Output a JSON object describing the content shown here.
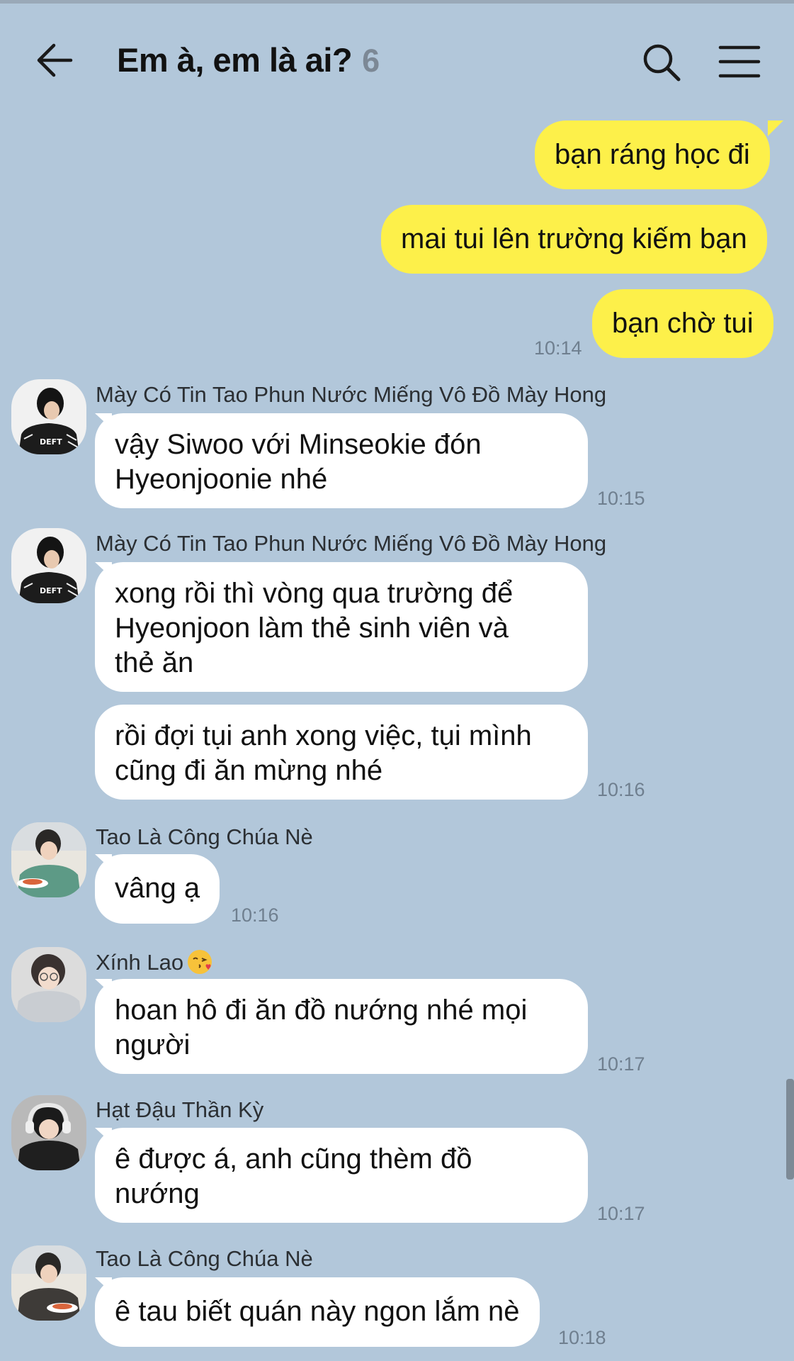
{
  "header": {
    "title": "Em à, em là ai?",
    "member_count": "6",
    "back_icon": "arrow-left-icon",
    "search_icon": "search-icon",
    "menu_icon": "hamburger-menu-icon"
  },
  "colors": {
    "background": "#b2c7da",
    "my_bubble": "#fdf04a",
    "other_bubble": "#ffffff",
    "time_text": "#6f7f8f"
  },
  "messages": [
    {
      "from": "me",
      "text": "bạn ráng học đi"
    },
    {
      "from": "me",
      "text": "mai tui lên trường kiếm bạn"
    },
    {
      "from": "me",
      "text": "bạn chờ tui",
      "time": "10:14"
    },
    {
      "sender": "Mày Có Tin Tao Phun Nước Miếng Vô Đồ Mày Hong",
      "avatar_text": "DEFT",
      "lines": [
        "vậy Siwoo với Minseokie đón",
        "Hyeonjoonie nhé"
      ],
      "time": "10:15"
    },
    {
      "sender": "Mày Có Tin Tao Phun Nước Miếng Vô Đồ Mày Hong",
      "avatar_text": "DEFT",
      "lines": [
        "xong rồi thì vòng qua trường để",
        "Hyeonjoon làm thẻ sinh viên và",
        "thẻ ăn"
      ]
    },
    {
      "lines": [
        "rồi đợi tụi anh xong việc, tụi mình",
        "cũng đi ăn mừng nhé"
      ],
      "time": "10:16"
    },
    {
      "sender": "Tao Là Công Chúa Nè",
      "lines": [
        "vâng ạ"
      ],
      "time": "10:16"
    },
    {
      "sender": "Xính Lao",
      "sender_emoji": "face-blowing-kiss-emoji",
      "lines": [
        "hoan hô đi ăn đồ nướng nhé mọi",
        "người"
      ],
      "time": "10:17"
    },
    {
      "sender": "Hạt Đậu Thần Kỳ",
      "lines": [
        "ê được á, anh cũng thèm đồ",
        "nướng"
      ],
      "time": "10:17"
    },
    {
      "sender": "Tao Là Công Chúa Nè",
      "lines": [
        "ê tau biết quán này ngon lắm nè"
      ],
      "time": "10:18"
    }
  ]
}
